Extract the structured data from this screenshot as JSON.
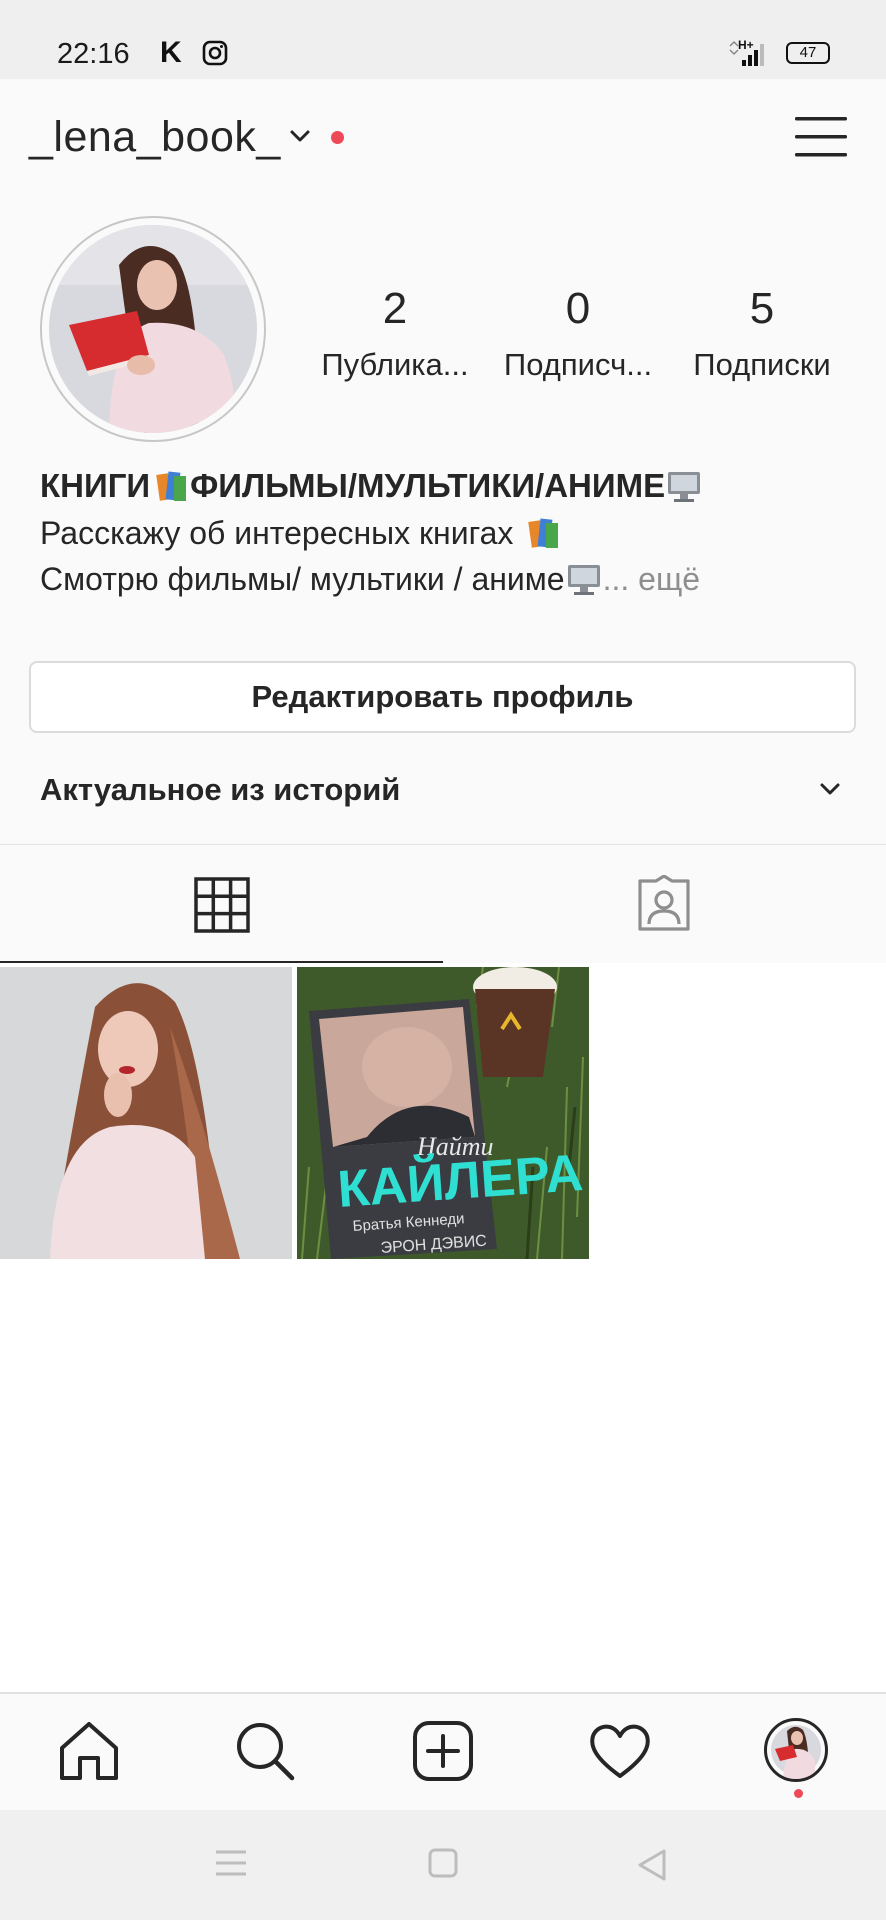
{
  "status_bar": {
    "time": "22:16",
    "notif_letter": "K",
    "network": "H+",
    "battery": "47"
  },
  "header": {
    "username": "_lena_book_"
  },
  "profile": {
    "stats": [
      {
        "count": "2",
        "label": "Публика..."
      },
      {
        "count": "0",
        "label": "Подписч..."
      },
      {
        "count": "5",
        "label": "Подписки"
      }
    ],
    "bio_name": "КНИГИ",
    "bio_name_2": "ФИЛЬМЫ/МУЛЬТИКИ/АНИМЕ",
    "bio_line1": "Расскажу об интересных книгах",
    "bio_line2": "Смотрю фильмы/ мультики / аниме",
    "bio_more": "... ещё",
    "edit_button": "Редактировать профиль",
    "highlights_label": "Актуальное из историй"
  },
  "tabs": [
    {
      "icon": "grid-icon",
      "active": true
    },
    {
      "icon": "tagged-icon",
      "active": false
    }
  ],
  "posts": [
    {
      "icon": "photo-portrait"
    },
    {
      "icon": "photo-book",
      "book_title_script": "Найти",
      "book_title": "КАЙЛЕРА",
      "book_series": "Братья Кеннеди",
      "book_author": "ЭРОН ДЭВИС"
    }
  ],
  "bottom_nav": [
    {
      "icon": "home-icon"
    },
    {
      "icon": "search-icon"
    },
    {
      "icon": "add-post-icon"
    },
    {
      "icon": "heart-icon"
    },
    {
      "icon": "profile-avatar-icon"
    }
  ],
  "colors": {
    "accent_red": "#ed4956",
    "text": "#262626",
    "muted": "#8e8e8e",
    "book_title_cyan": "#2fe0d2"
  }
}
